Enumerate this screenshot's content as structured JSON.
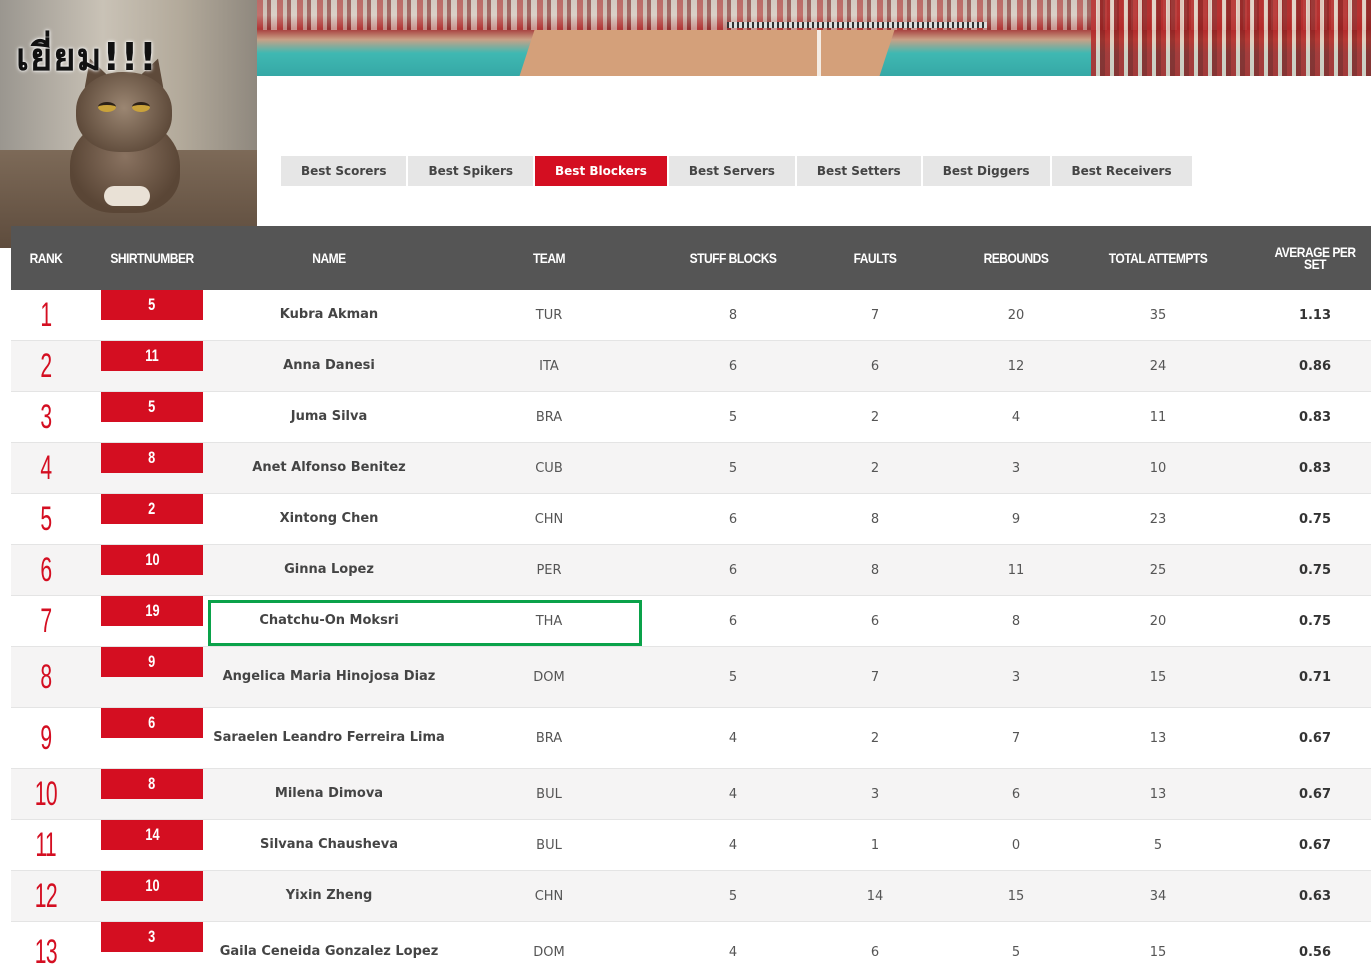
{
  "meme": {
    "caption": "เยี่ยม!!!"
  },
  "tabs": [
    {
      "label": "Best Scorers",
      "active": false
    },
    {
      "label": "Best Spikers",
      "active": false
    },
    {
      "label": "Best Blockers",
      "active": true
    },
    {
      "label": "Best Servers",
      "active": false
    },
    {
      "label": "Best Setters",
      "active": false
    },
    {
      "label": "Best Diggers",
      "active": false
    },
    {
      "label": "Best Receivers",
      "active": false
    }
  ],
  "table": {
    "headers": {
      "rank": "RANK",
      "shirtnumber": "SHIRTNUMBER",
      "name": "NAME",
      "team": "TEAM",
      "stuff_blocks": "STUFF BLOCKS",
      "faults": "FAULTS",
      "rebounds": "REBOUNDS",
      "total_attempts": "TOTAL ATTEMPTS",
      "average_per_set": "AVERAGE PER SET"
    },
    "rows": [
      {
        "rank": "1",
        "shirt": "5",
        "name": "Kubra Akman",
        "team": "TUR",
        "stuff": "8",
        "faults": "7",
        "rebounds": "20",
        "attempts": "35",
        "avg": "1.13"
      },
      {
        "rank": "2",
        "shirt": "11",
        "name": "Anna Danesi",
        "team": "ITA",
        "stuff": "6",
        "faults": "6",
        "rebounds": "12",
        "attempts": "24",
        "avg": "0.86"
      },
      {
        "rank": "3",
        "shirt": "5",
        "name": "Juma Silva",
        "team": "BRA",
        "stuff": "5",
        "faults": "2",
        "rebounds": "4",
        "attempts": "11",
        "avg": "0.83"
      },
      {
        "rank": "4",
        "shirt": "8",
        "name": "Anet Alfonso Benitez",
        "team": "CUB",
        "stuff": "5",
        "faults": "2",
        "rebounds": "3",
        "attempts": "10",
        "avg": "0.83"
      },
      {
        "rank": "5",
        "shirt": "2",
        "name": "Xintong Chen",
        "team": "CHN",
        "stuff": "6",
        "faults": "8",
        "rebounds": "9",
        "attempts": "23",
        "avg": "0.75"
      },
      {
        "rank": "6",
        "shirt": "10",
        "name": "Ginna Lopez",
        "team": "PER",
        "stuff": "6",
        "faults": "8",
        "rebounds": "11",
        "attempts": "25",
        "avg": "0.75"
      },
      {
        "rank": "7",
        "shirt": "19",
        "name": "Chatchu-On Moksri",
        "team": "THA",
        "stuff": "6",
        "faults": "6",
        "rebounds": "8",
        "attempts": "20",
        "avg": "0.75"
      },
      {
        "rank": "8",
        "shirt": "9",
        "name": "Angelica Maria Hinojosa Diaz",
        "team": "DOM",
        "stuff": "5",
        "faults": "7",
        "rebounds": "3",
        "attempts": "15",
        "avg": "0.71"
      },
      {
        "rank": "9",
        "shirt": "6",
        "name": "Saraelen Leandro Ferreira Lima",
        "team": "BRA",
        "stuff": "4",
        "faults": "2",
        "rebounds": "7",
        "attempts": "13",
        "avg": "0.67"
      },
      {
        "rank": "10",
        "shirt": "8",
        "name": "Milena Dimova",
        "team": "BUL",
        "stuff": "4",
        "faults": "3",
        "rebounds": "6",
        "attempts": "13",
        "avg": "0.67"
      },
      {
        "rank": "11",
        "shirt": "14",
        "name": "Silvana Chausheva",
        "team": "BUL",
        "stuff": "4",
        "faults": "1",
        "rebounds": "0",
        "attempts": "5",
        "avg": "0.67"
      },
      {
        "rank": "12",
        "shirt": "10",
        "name": "Yixin Zheng",
        "team": "CHN",
        "stuff": "5",
        "faults": "14",
        "rebounds": "15",
        "attempts": "34",
        "avg": "0.63"
      },
      {
        "rank": "13",
        "shirt": "3",
        "name": "Gaila Ceneida Gonzalez Lopez",
        "team": "DOM",
        "stuff": "4",
        "faults": "6",
        "rebounds": "5",
        "attempts": "15",
        "avg": "0.56"
      }
    ]
  },
  "colors": {
    "accent": "#d40e21",
    "header_bg": "#555555",
    "highlight_border": "#0aa24a"
  }
}
